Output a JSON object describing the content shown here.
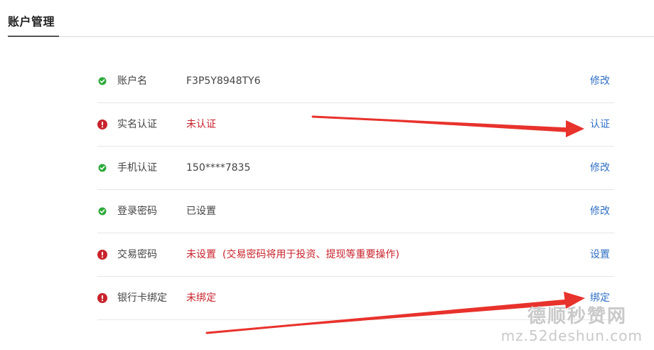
{
  "page": {
    "title": "账户管理"
  },
  "colors": {
    "ok": "#2eaa3a",
    "warn": "#c8232c",
    "link": "#2f6fc4",
    "arrow": "#e8322c"
  },
  "rows": [
    {
      "status": "ok",
      "icon": "check-circle-icon",
      "label": "账户名",
      "value": "F3P5Y8948TY6",
      "action": "修改"
    },
    {
      "status": "warn",
      "icon": "exclamation-circle-icon",
      "label": "实名认证",
      "value": "未认证",
      "action": "认证"
    },
    {
      "status": "ok",
      "icon": "check-circle-icon",
      "label": "手机认证",
      "value": "150****7835",
      "action": "修改"
    },
    {
      "status": "ok",
      "icon": "check-circle-icon",
      "label": "登录密码",
      "value": "已设置",
      "action": "修改"
    },
    {
      "status": "warn",
      "icon": "exclamation-circle-icon",
      "label": "交易密码",
      "value": "未设置  (交易密码将用于投资、提现等重要操作)",
      "action": "设置"
    },
    {
      "status": "warn",
      "icon": "exclamation-circle-icon",
      "label": "银行卡绑定",
      "value": "未绑定",
      "action": "绑定"
    }
  ],
  "watermark": {
    "title": "德顺秒赞网",
    "url": "mz.52deshun.com"
  }
}
